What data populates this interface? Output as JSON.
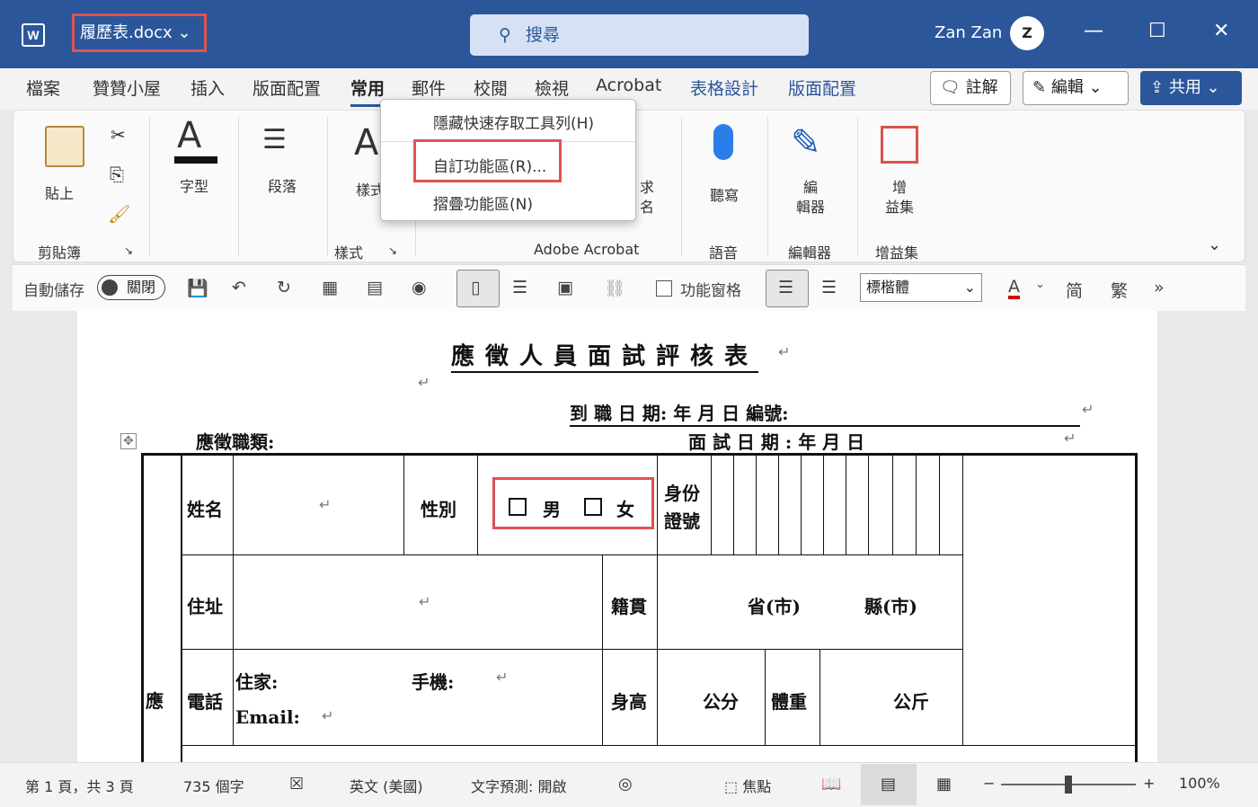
{
  "titlebar": {
    "app_icon": "W",
    "doc_name": "履歷表.docx",
    "search_label": "搜尋",
    "user_name": "Zan Zan",
    "avatar_letter": "Z"
  },
  "menu": [
    "檔案",
    "贊贊小屋",
    "插入",
    "版面配置",
    "常用",
    "郵件",
    "校閱",
    "檢視",
    "Acrobat",
    "表格設計",
    "版面配置"
  ],
  "actions": {
    "comment": "註解",
    "edit": "編輯",
    "share": "共用"
  },
  "ribbon": {
    "paste": "貼上",
    "clipboard": "剪貼簿",
    "font": "字型",
    "paragraph": "段落",
    "styles_group": "樣式",
    "style_btn": "樣式",
    "acrobat_group": "Adobe Acrobat",
    "dictate": "聽寫",
    "voice_group": "語音",
    "editor": "編\n輯器",
    "editor_group": "編輯器",
    "addins": "增\n益集",
    "addins_group": "增益集",
    "sign": "求\n名"
  },
  "context_menu": [
    "隱藏快速存取工具列(H)",
    "自訂功能區(R)...",
    "摺疊功能區(N)"
  ],
  "qat": {
    "autosave": "自動儲存",
    "toggle": "關閉",
    "nav_pane": "功能窗格",
    "font": "標楷體",
    "simplified": "简",
    "traditional": "繁",
    "more": "»"
  },
  "document": {
    "title": "應徵人員面試評核表",
    "start_date": "到 職 日 期:  年  月  日  編號:",
    "job_type": "應徵職類:",
    "interview_date": "面 試 日 期 :     年    月    日",
    "name": "姓名",
    "gender": "性別",
    "male": "男",
    "female": "女",
    "id": "身份\n證號",
    "address": "住址",
    "native": "籍貫",
    "province": "省(市)",
    "county": "縣(市)",
    "phone": "電話",
    "home": "住家:",
    "mobile": "手機:",
    "email": "Email:",
    "height": "身高",
    "cm": "公分",
    "weight": "體重",
    "kg": "公斤",
    "side": "應"
  },
  "status": {
    "page": "第 1 頁，共 3 頁",
    "words": "735 個字",
    "lang": "英文 (美國)",
    "predict": "文字預測: 開啟",
    "focus": "焦點",
    "zoom": "100%"
  }
}
